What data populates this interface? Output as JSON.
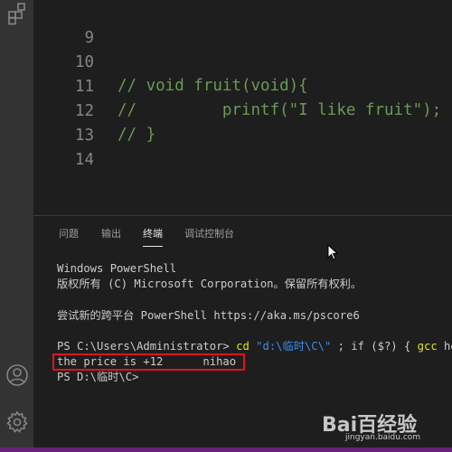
{
  "editor": {
    "lines": [
      {
        "num": "9",
        "code": ""
      },
      {
        "num": "10",
        "code": "// void fruit(void){"
      },
      {
        "num": "11",
        "code": "//         printf(\"I like fruit\");"
      },
      {
        "num": "12",
        "code": "// }"
      },
      {
        "num": "13",
        "code": ""
      },
      {
        "num": "14",
        "code": ""
      }
    ]
  },
  "panel": {
    "tabs": [
      {
        "label": "问题",
        "active": false
      },
      {
        "label": "输出",
        "active": false
      },
      {
        "label": "终端",
        "active": true
      },
      {
        "label": "调试控制台",
        "active": false
      }
    ]
  },
  "terminal": {
    "line1": "Windows PowerShell",
    "line2": "版权所有 (C) Microsoft Corporation。保留所有权利。",
    "line3": "尝试新的跨平台 PowerShell https://aka.ms/pscore6",
    "cmd_prompt": "PS C:\\Users\\Administrator> ",
    "cmd_cd": "cd",
    "cmd_path": "\"d:\\临时\\C\\\"",
    "cmd_sep": " ; ",
    "cmd_if": "if",
    "cmd_cond": " ($?) { ",
    "cmd_gcc": "gcc",
    "cmd_rest": " hel",
    "output": "the price is +12      nihao",
    "prompt2": "PS D:\\临时\\C>"
  },
  "watermark": {
    "brand": "Bai百经验",
    "url": "jingyan.baidu.com"
  },
  "colors": {
    "accent_status": "#68217a",
    "highlight_box": "#e0141b",
    "comment": "#6a9955"
  }
}
